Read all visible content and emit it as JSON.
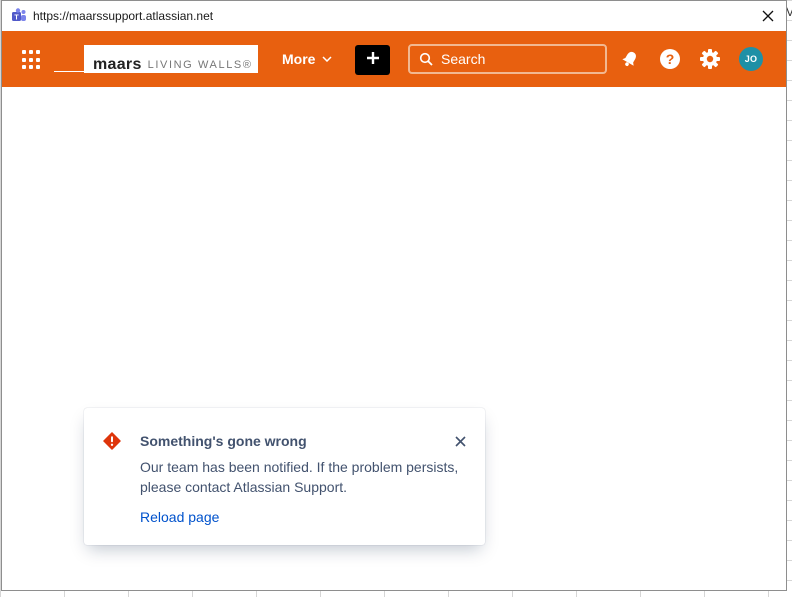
{
  "background": {
    "fragment_text": "V"
  },
  "window": {
    "url": "https://maarssupport.atlassian.net",
    "app_icon": "teams-icon",
    "close_icon": "close-icon"
  },
  "navbar": {
    "color": "#e8600f",
    "app_switcher_icon": "app-switcher-grid-icon",
    "logo": {
      "main": "maars",
      "sub": "LIVING WALLS®"
    },
    "more_label": "More",
    "create_icon": "plus-icon",
    "search": {
      "placeholder": "Search",
      "icon": "search-icon"
    },
    "icons": [
      "notifications-icon",
      "help-icon",
      "settings-icon"
    ],
    "avatar_initials": "JO",
    "avatar_color": "#1e90a6"
  },
  "flag": {
    "icon": "error-icon",
    "icon_color": "#de350b",
    "title": "Something's gone wrong",
    "body": "Our team has been notified. If the problem persists, please contact Atlassian Support.",
    "action_label": "Reload page",
    "close_icon": "close-icon"
  }
}
